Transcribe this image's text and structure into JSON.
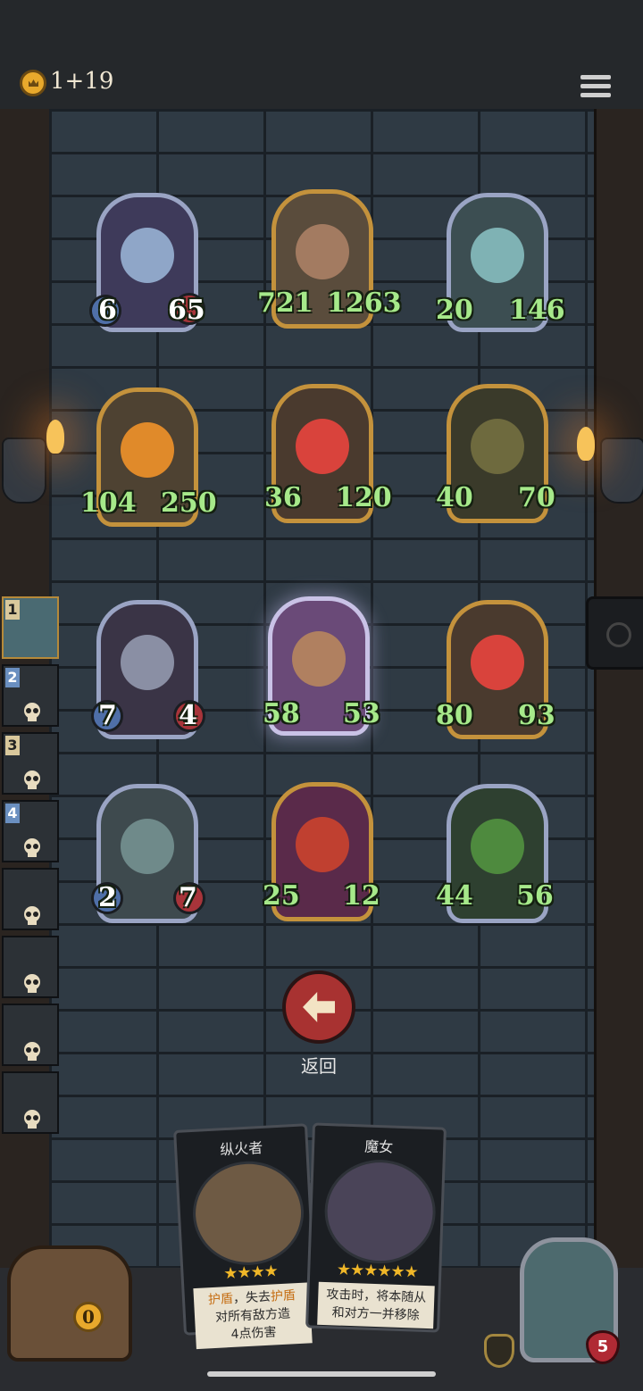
{
  "top_bar": {
    "gold_text": "1+19",
    "coin_icon": "crown-coin-icon",
    "menu_icon": "hamburger-menu-icon"
  },
  "enemy_board": [
    {
      "attack": "6",
      "health": "65"
    },
    {
      "attack": "721",
      "health": "1263"
    },
    {
      "attack": "20",
      "health": "146"
    },
    {
      "attack": "104",
      "health": "250"
    },
    {
      "attack": "36",
      "health": "120"
    },
    {
      "attack": "40",
      "health": "70"
    }
  ],
  "player_board": [
    {
      "attack": "7",
      "health": "4"
    },
    {
      "attack": "58",
      "health": "53"
    },
    {
      "attack": "80",
      "health": "93"
    },
    {
      "attack": "2",
      "health": "7"
    },
    {
      "attack": "25",
      "health": "12"
    },
    {
      "attack": "44",
      "health": "56"
    }
  ],
  "opponents": [
    "1",
    "2",
    "3",
    "4"
  ],
  "back_button": {
    "label": "返回"
  },
  "hand": [
    {
      "name": "纵火者",
      "stars": "★★★★",
      "desc_keyword": "护盾",
      "desc_mid": "，失去",
      "desc_keyword2": "护盾",
      "desc_rest": "对所有敌方造",
      "desc_rest2": "4点伤害"
    },
    {
      "name": "魔女",
      "stars": "★★★★★★",
      "desc_line1": "攻击时，将本随从",
      "desc_line2": "和对方一并移除"
    }
  ],
  "bottom": {
    "coins": "0",
    "hero_health": "5"
  },
  "colors": {
    "stat_green": "#a6e98a",
    "gold_border": "#c4923c",
    "back_red": "#a83231"
  }
}
